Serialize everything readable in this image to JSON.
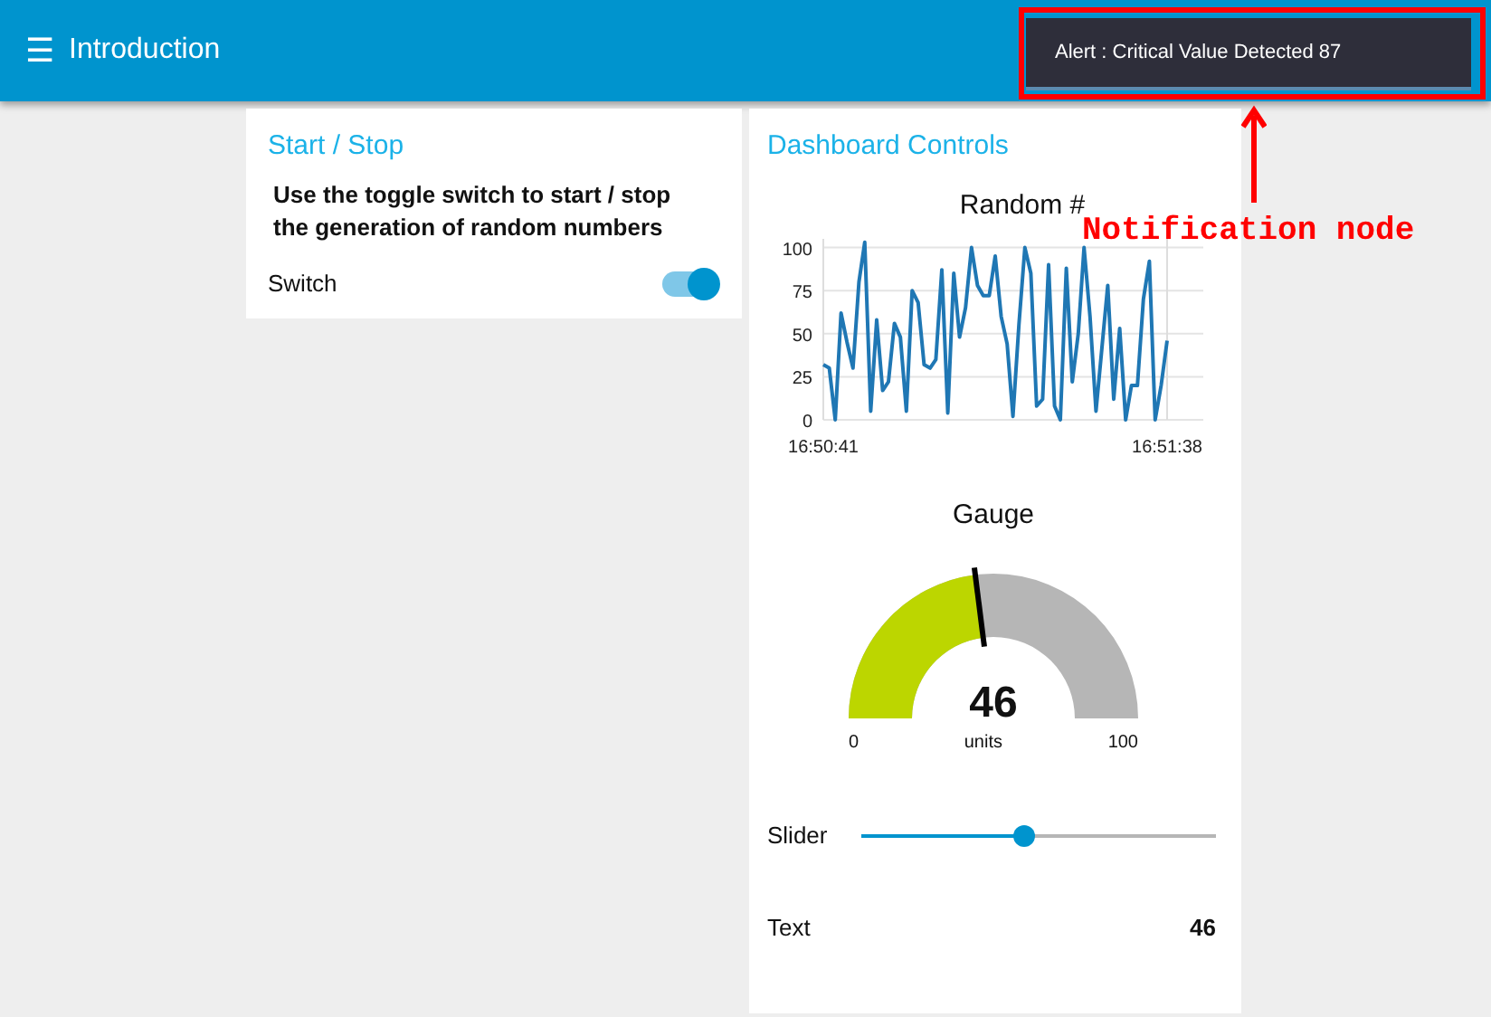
{
  "header": {
    "menu_icon": "☰",
    "title": "Introduction"
  },
  "notification": {
    "text": "Alert : Critical Value Detected 87"
  },
  "annotation": {
    "label": "Notification node"
  },
  "start_stop": {
    "title": "Start / Stop",
    "description": "Use the toggle switch to start / stop the generation of random numbers",
    "switch": {
      "label": "Switch",
      "on": true
    }
  },
  "dashboard": {
    "title": "Dashboard Controls",
    "chart": {
      "chart_data": {
        "type": "line",
        "title": "Random #",
        "grid": true,
        "ylim": [
          0,
          105
        ],
        "yticks": [
          0,
          25,
          50,
          75,
          100
        ],
        "categories": [
          "16:50:41",
          null,
          null,
          null,
          null,
          null,
          null,
          null,
          null,
          null,
          null,
          null,
          null,
          null,
          null,
          null,
          null,
          null,
          null,
          null,
          null,
          null,
          null,
          null,
          null,
          null,
          null,
          null,
          null,
          null,
          null,
          null,
          null,
          null,
          null,
          null,
          null,
          null,
          null,
          null,
          null,
          null,
          null,
          null,
          null,
          null,
          null,
          null,
          null,
          null,
          null,
          null,
          null,
          null,
          null,
          null,
          null,
          null,
          "16:51:38"
        ],
        "series": [
          {
            "color": "#1f77b4",
            "values": [
              32,
              30,
              0,
              62,
              45,
              30,
              80,
              103,
              5,
              58,
              17,
              22,
              56,
              48,
              5,
              75,
              68,
              32,
              30,
              35,
              87,
              4,
              85,
              48,
              65,
              100,
              78,
              72,
              72,
              95,
              60,
              44,
              2,
              55,
              100,
              85,
              8,
              12,
              90,
              8,
              0,
              88,
              22,
              50,
              100,
              60,
              5,
              42,
              78,
              12,
              53,
              0,
              20,
              20,
              70,
              92,
              0,
              20,
              46
            ]
          }
        ]
      }
    },
    "gauge": {
      "title": "Gauge",
      "value": "46",
      "units": "units",
      "min": "0",
      "max": "100",
      "level": 0.46
    },
    "slider": {
      "label": "Slider",
      "level": 0.46
    },
    "text": {
      "label": "Text",
      "value": "46"
    }
  }
}
